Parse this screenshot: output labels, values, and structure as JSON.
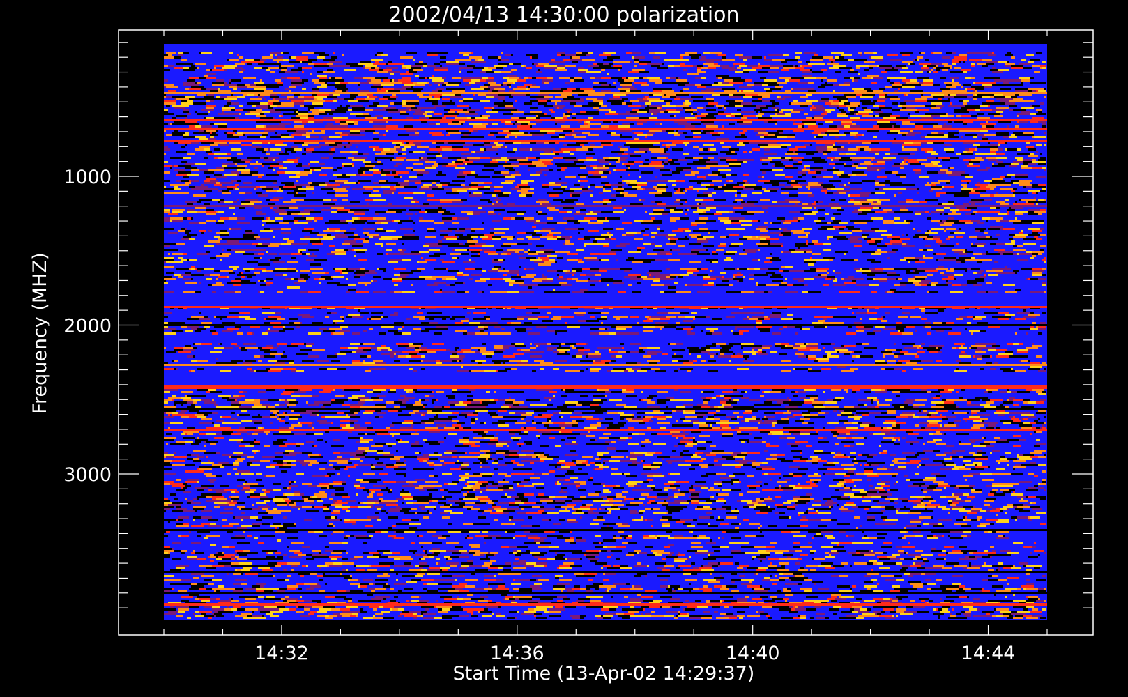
{
  "chart_data": {
    "type": "heatmap",
    "title": "2002/04/13 14:30:00 polarization",
    "xlabel": "Start Time (13-Apr-02 14:29:37)",
    "ylabel": "Frequency (MHZ)",
    "x_ticks": [
      "14:32",
      "14:36",
      "14:40",
      "14:44"
    ],
    "y_ticks": [
      "1000",
      "2000",
      "3000"
    ],
    "x_range_minutes": [
      0,
      15
    ],
    "y_range_mhz": [
      100,
      4000
    ],
    "y_direction": "increasing-downward",
    "colors": {
      "background": "#000000",
      "dominant": "#1a1aff",
      "accents": [
        "#ff2a1a",
        "#ff8c1a",
        "#ffd21a",
        "#7a1a7a",
        "#000000"
      ]
    }
  }
}
